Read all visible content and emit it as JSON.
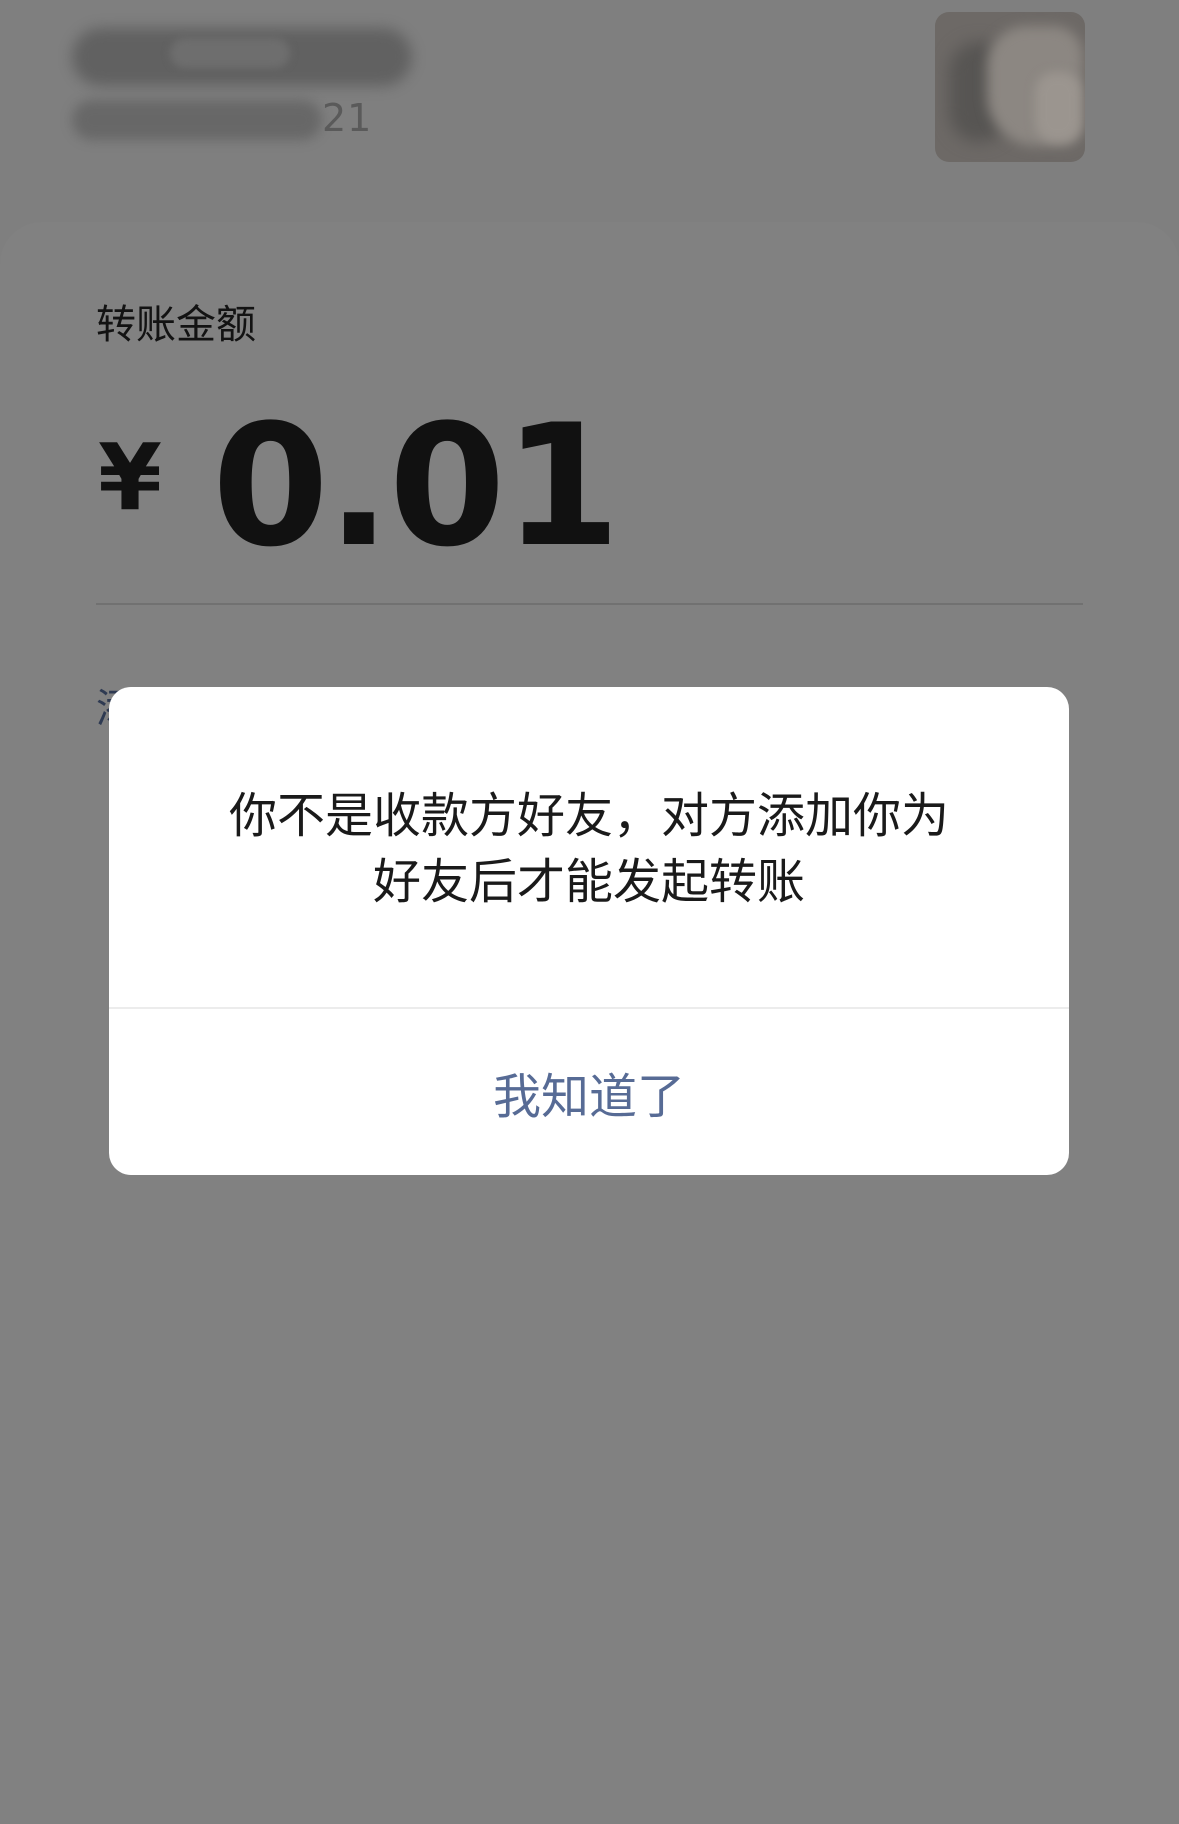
{
  "header": {
    "recipient_account_visible": "21"
  },
  "transfer": {
    "amount_label": "转账金额",
    "currency_symbol": "¥",
    "amount": "0.01",
    "add_note_link": "添加转账说明"
  },
  "dialog": {
    "message_line1": "你不是收款方好友，对方添加你为",
    "message_line2": "好友后才能发起转账",
    "confirm_button": "我知道了"
  },
  "colors": {
    "overlay_background": "#7f7f7f",
    "dialog_background": "#ffffff",
    "dialog_button_text": "#576b95",
    "link_text": "#2e3a52"
  },
  "icons": {
    "avatar": "recipient-avatar-image"
  }
}
